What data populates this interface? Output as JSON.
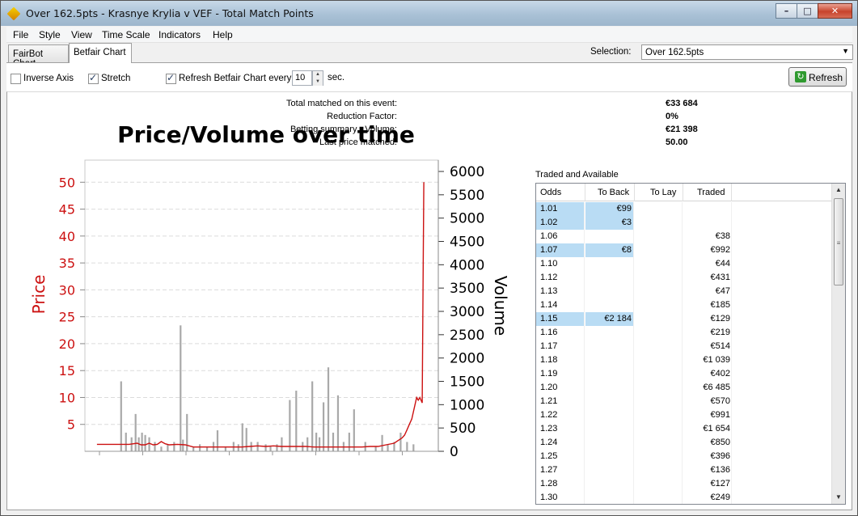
{
  "window": {
    "title": "Over 162.5pts - Krasnye Krylia v VEF - Total Match Points",
    "controls": {
      "minimize": "–",
      "maximize": "□",
      "close": "✕"
    }
  },
  "menu": {
    "items": [
      "File",
      "Style",
      "View",
      "Time Scale",
      "Indicators",
      "Help"
    ]
  },
  "tabs": {
    "items": [
      "FairBot Chart",
      "Betfair Chart"
    ],
    "active": "Betfair Chart"
  },
  "selection": {
    "label": "Selection:",
    "value": "Over 162.5pts"
  },
  "toolbar": {
    "inverse_axis": {
      "label": "Inverse Axis",
      "checked": false
    },
    "stretch": {
      "label": "Stretch",
      "checked": true
    },
    "auto_refresh": {
      "label": "Refresh Betfair Chart every",
      "checked": true
    },
    "refresh_seconds": "10",
    "seconds_unit": "sec.",
    "refresh_button": "Refresh"
  },
  "summary": {
    "total_matched": {
      "label": "Total matched on this event:",
      "value": "€33 684"
    },
    "reduction_factor": {
      "label": "Reduction Factor:",
      "value": "0%"
    },
    "betting_summary": {
      "label": "Betting summary - Volume:",
      "value": "€21 398"
    },
    "last_price": {
      "label": "Last price matched:",
      "value": "50.00"
    }
  },
  "traded_table": {
    "title": "Traded and Available",
    "columns": [
      "Odds",
      "To Back",
      "To Lay",
      "Traded"
    ],
    "rows": [
      {
        "odds": "1.01",
        "back": "€99",
        "lay": "",
        "traded": ""
      },
      {
        "odds": "1.02",
        "back": "€3",
        "lay": "",
        "traded": ""
      },
      {
        "odds": "1.06",
        "back": "",
        "lay": "",
        "traded": "€38"
      },
      {
        "odds": "1.07",
        "back": "€8",
        "lay": "",
        "traded": "€992"
      },
      {
        "odds": "1.10",
        "back": "",
        "lay": "",
        "traded": "€44"
      },
      {
        "odds": "1.12",
        "back": "",
        "lay": "",
        "traded": "€431"
      },
      {
        "odds": "1.13",
        "back": "",
        "lay": "",
        "traded": "€47"
      },
      {
        "odds": "1.14",
        "back": "",
        "lay": "",
        "traded": "€185"
      },
      {
        "odds": "1.15",
        "back": "€2 184",
        "lay": "",
        "traded": "€129"
      },
      {
        "odds": "1.16",
        "back": "",
        "lay": "",
        "traded": "€219"
      },
      {
        "odds": "1.17",
        "back": "",
        "lay": "",
        "traded": "€514"
      },
      {
        "odds": "1.18",
        "back": "",
        "lay": "",
        "traded": "€1 039"
      },
      {
        "odds": "1.19",
        "back": "",
        "lay": "",
        "traded": "€402"
      },
      {
        "odds": "1.20",
        "back": "",
        "lay": "",
        "traded": "€6 485"
      },
      {
        "odds": "1.21",
        "back": "",
        "lay": "",
        "traded": "€570"
      },
      {
        "odds": "1.22",
        "back": "",
        "lay": "",
        "traded": "€991"
      },
      {
        "odds": "1.23",
        "back": "",
        "lay": "",
        "traded": "€1 654"
      },
      {
        "odds": "1.24",
        "back": "",
        "lay": "",
        "traded": "€850"
      },
      {
        "odds": "1.25",
        "back": "",
        "lay": "",
        "traded": "€396"
      },
      {
        "odds": "1.27",
        "back": "",
        "lay": "",
        "traded": "€136"
      },
      {
        "odds": "1.28",
        "back": "",
        "lay": "",
        "traded": "€127"
      },
      {
        "odds": "1.30",
        "back": "",
        "lay": "",
        "traded": "€249"
      }
    ]
  },
  "colors": {
    "price_line": "#cc1111",
    "volume_bars": "#a9a9a9",
    "highlight": "#b9dcf4"
  },
  "chart_data": {
    "type": "line",
    "title": "Price/Volume over time",
    "ylabel": "Price",
    "y2label": "Volume",
    "ylim": [
      0,
      52
    ],
    "y2lim": [
      0,
      6000
    ],
    "y_ticks": [
      5,
      10,
      15,
      20,
      25,
      30,
      35,
      40,
      45,
      50
    ],
    "y2_ticks": [
      0,
      500,
      1000,
      1500,
      2000,
      2500,
      3000,
      3500,
      4000,
      4500,
      5000,
      5500,
      6000
    ],
    "grid": true,
    "series": [
      {
        "name": "Price",
        "axis": "left",
        "x": [
          0,
          10,
          20,
          30,
          40,
          50,
          55,
          60,
          65,
          70,
          75,
          80,
          85,
          90,
          100,
          110,
          120,
          130,
          140,
          150,
          160,
          170,
          180,
          190,
          200,
          210,
          220,
          230,
          240,
          250,
          260,
          270,
          280,
          290,
          300,
          310,
          320,
          330,
          340,
          350,
          360,
          370,
          375,
          380,
          383,
          386,
          389,
          392,
          395,
          398,
          400,
          402,
          405,
          406,
          407
        ],
        "values": [
          1.3,
          1.3,
          1.3,
          1.3,
          1.3,
          1.5,
          1.2,
          1.2,
          1.5,
          1.2,
          1.3,
          1.8,
          1.4,
          1.2,
          1.3,
          1.2,
          0.8,
          0.8,
          0.8,
          0.8,
          0.8,
          0.8,
          0.8,
          0.9,
          1.0,
          0.9,
          1.0,
          0.9,
          0.9,
          0.9,
          0.9,
          0.8,
          0.8,
          0.8,
          0.8,
          0.8,
          0.8,
          0.8,
          0.9,
          0.9,
          1.2,
          1.5,
          2.0,
          2.5,
          3.0,
          4.0,
          5.0,
          6.0,
          8.0,
          10.0,
          9.5,
          10.0,
          9.0,
          30.0,
          50.0
        ]
      },
      {
        "name": "Volume",
        "axis": "right",
        "type": "bar",
        "x": [
          30,
          36,
          43,
          48,
          52,
          56,
          60,
          65,
          72,
          80,
          88,
          96,
          104,
          107,
          112,
          120,
          128,
          137,
          145,
          150,
          160,
          170,
          176,
          181,
          186,
          192,
          200,
          210,
          216,
          224,
          230,
          240,
          248,
          256,
          262,
          268,
          273,
          277,
          282,
          288,
          294,
          300,
          307,
          314,
          320,
          334,
          347,
          355,
          362,
          370,
          378,
          386,
          394
        ],
        "values": [
          1500,
          400,
          300,
          800,
          300,
          400,
          350,
          300,
          200,
          100,
          150,
          200,
          2700,
          250,
          800,
          100,
          150,
          100,
          200,
          450,
          100,
          200,
          150,
          600,
          500,
          200,
          200,
          150,
          100,
          150,
          300,
          1100,
          1300,
          200,
          300,
          1500,
          400,
          300,
          1050,
          1800,
          400,
          1200,
          200,
          400,
          900,
          200,
          100,
          350,
          150,
          200,
          400,
          200,
          150
        ]
      }
    ]
  }
}
